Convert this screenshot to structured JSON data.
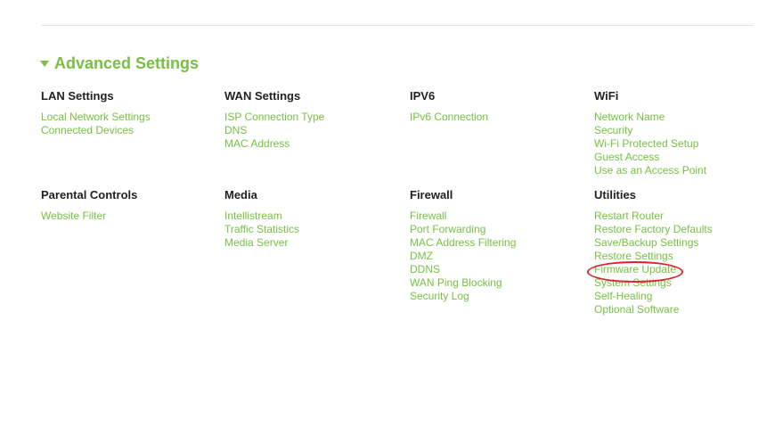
{
  "section": {
    "title": "Advanced Settings",
    "toggle_icon": "caret-down-icon"
  },
  "colors": {
    "accent": "#77c044",
    "heading": "#222222",
    "annotation": "#d7262b"
  },
  "groups": [
    {
      "title": "LAN Settings",
      "links": [
        "Local Network Settings",
        "Connected Devices"
      ]
    },
    {
      "title": "WAN Settings",
      "links": [
        "ISP Connection Type",
        "DNS",
        "MAC Address"
      ]
    },
    {
      "title": "IPV6",
      "links": [
        "IPv6 Connection"
      ]
    },
    {
      "title": "WiFi",
      "links": [
        "Network Name",
        "Security",
        "Wi-Fi Protected Setup",
        "Guest Access",
        "Use as an Access Point"
      ]
    },
    {
      "title": "Parental Controls",
      "links": [
        "Website Filter"
      ]
    },
    {
      "title": "Media",
      "links": [
        "Intellistream",
        "Traffic Statistics",
        "Media Server"
      ]
    },
    {
      "title": "Firewall",
      "links": [
        "Firewall",
        "Port Forwarding",
        "MAC Address Filtering",
        "DMZ",
        "DDNS",
        "WAN Ping Blocking",
        "Security Log"
      ]
    },
    {
      "title": "Utilities",
      "links": [
        "Restart Router",
        "Restore Factory Defaults",
        "Save/Backup Settings",
        "Restore Settings",
        "Firmware Update",
        "System Settings",
        "Self-Healing",
        "Optional Software"
      ]
    }
  ]
}
